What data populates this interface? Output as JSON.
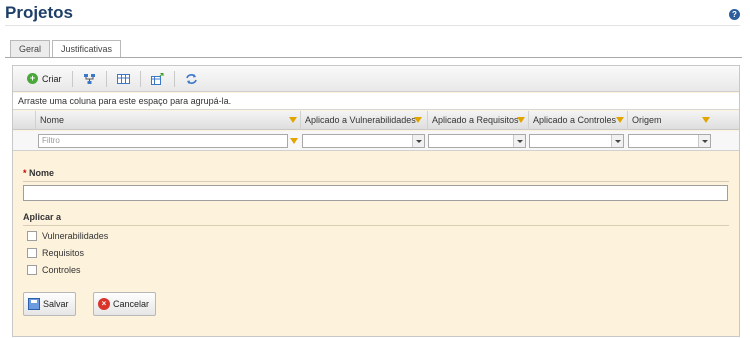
{
  "page": {
    "title": "Projetos",
    "help_icon": "?"
  },
  "tabs": [
    {
      "label": "Geral",
      "active": false
    },
    {
      "label": "Justificativas",
      "active": true
    }
  ],
  "toolbar": {
    "create_label": "Criar",
    "icons": [
      "create-icon",
      "hierarchy-icon",
      "columns-icon",
      "export-icon",
      "refresh-icon"
    ]
  },
  "grid": {
    "group_hint": "Arraste uma coluna para este espaço para agrupá-la.",
    "columns": [
      "Nome",
      "Aplicado a Vulnerabilidades",
      "Aplicado a Requisitos",
      "Aplicado a Controles",
      "Origem"
    ],
    "filter_placeholder": "Filtro"
  },
  "form": {
    "name_required_mark": "*",
    "name_label": "Nome",
    "name_value": "",
    "apply_section_label": "Aplicar a",
    "options": [
      {
        "label": "Vulnerabilidades",
        "checked": false
      },
      {
        "label": "Requisitos",
        "checked": false
      },
      {
        "label": "Controles",
        "checked": false
      }
    ],
    "save_label": "Salvar",
    "cancel_label": "Cancelar"
  },
  "colors": {
    "title": "#1f3f68",
    "panel_bg": "#fdf2dc",
    "filter_icon": "#e2a500",
    "create_icon": "#4aa83a",
    "cancel_icon": "#d9332a"
  }
}
